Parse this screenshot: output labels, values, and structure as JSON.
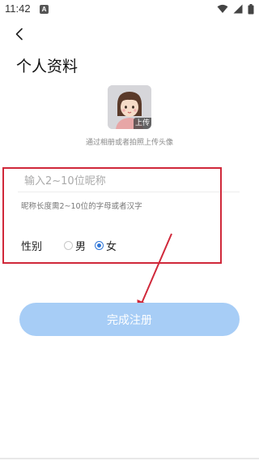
{
  "status_bar": {
    "time": "11:42",
    "notification_letter": "A",
    "icons": [
      "wifi-icon",
      "signal-icon",
      "battery-icon"
    ]
  },
  "header": {
    "back_icon": "chevron-left-icon",
    "title": "个人资料"
  },
  "avatar": {
    "upload_label": "上传",
    "hint": "通过相册或者拍照上传头像"
  },
  "form": {
    "nickname_placeholder": "输入2~10位昵称",
    "nickname_value": "",
    "nickname_hint": "昵称长度需2~10位的字母或者汉字",
    "gender_label": "性别",
    "gender_options": [
      "男",
      "女"
    ],
    "gender_selected": "女"
  },
  "submit": {
    "label": "完成注册"
  },
  "colors": {
    "annotation_red": "#d0283a",
    "accent_blue": "#2f76d8",
    "button_bg": "#a7cdf6"
  }
}
